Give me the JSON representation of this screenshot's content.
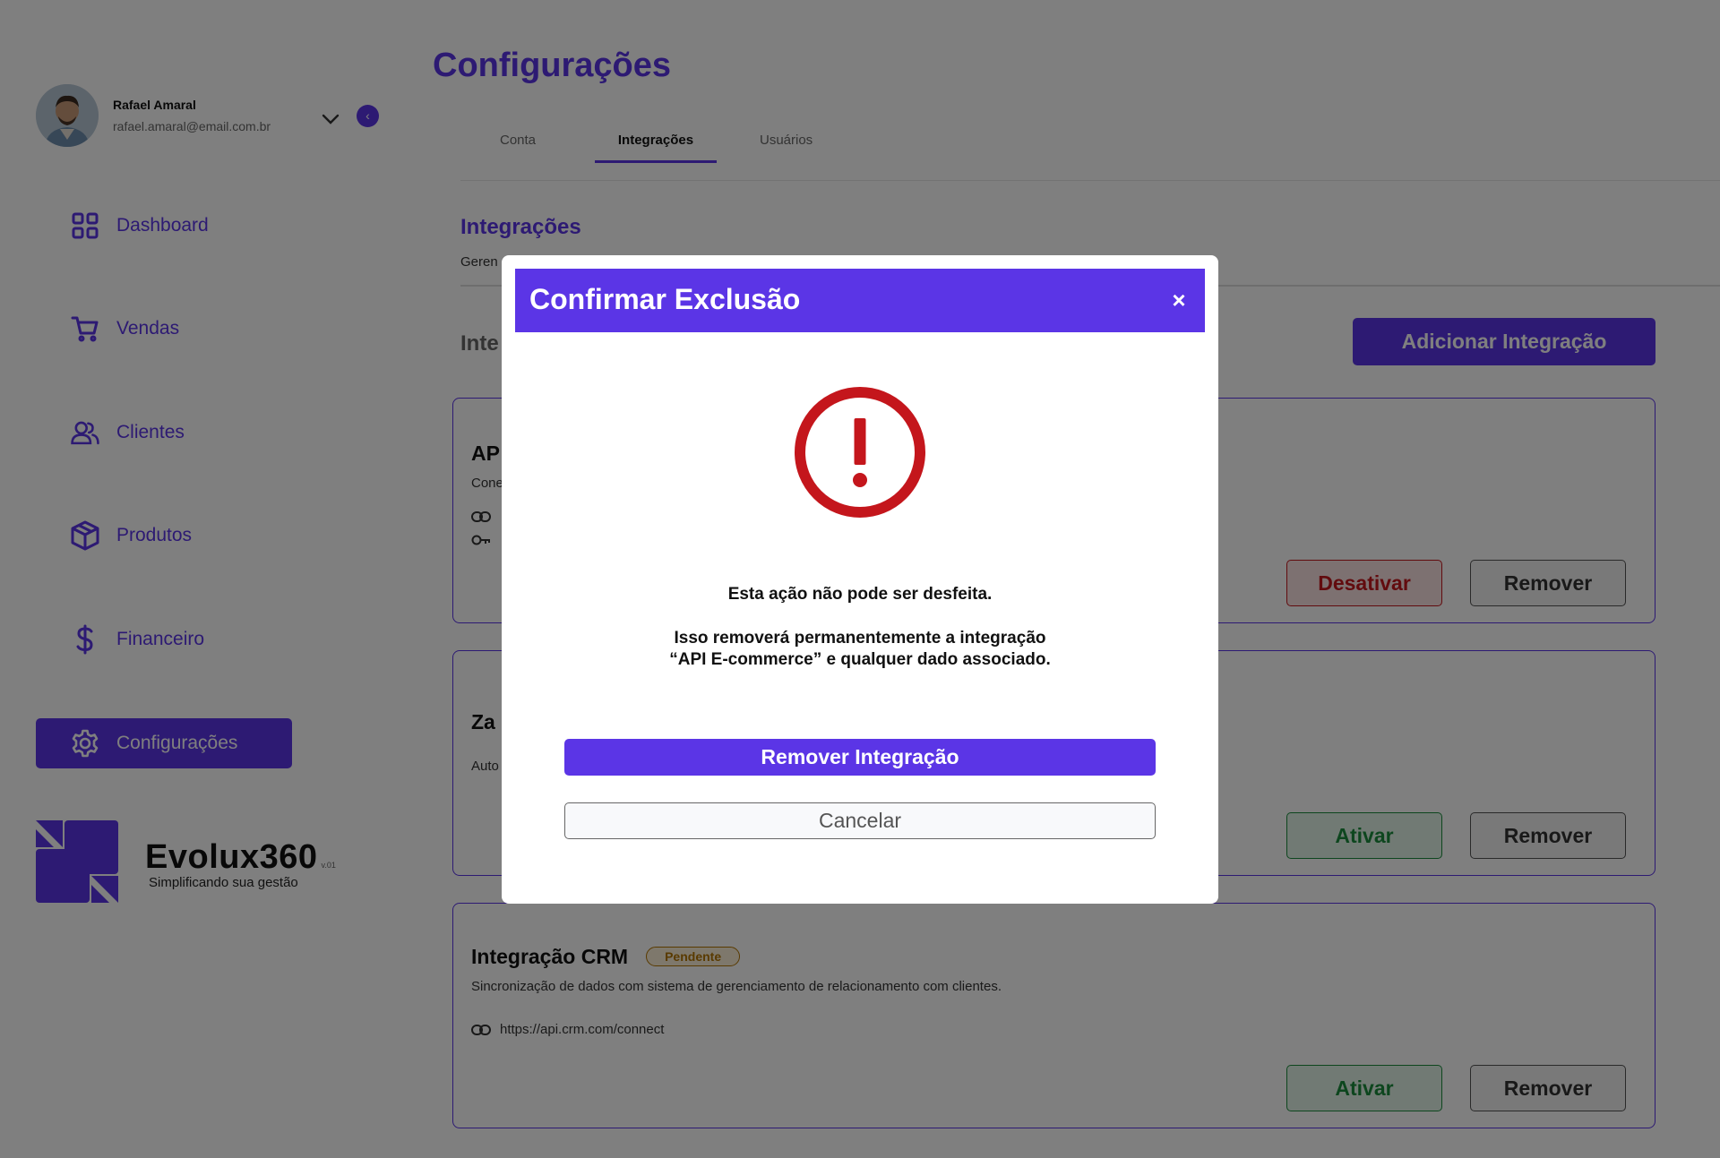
{
  "profile": {
    "name": "Rafael Amaral",
    "email": "rafael.amaral@email.com.br"
  },
  "sidebar": {
    "items": [
      {
        "label": "Dashboard",
        "icon": "grid-icon"
      },
      {
        "label": "Vendas",
        "icon": "cart-icon"
      },
      {
        "label": "Clientes",
        "icon": "users-icon"
      },
      {
        "label": "Produtos",
        "icon": "box-icon"
      },
      {
        "label": "Financeiro",
        "icon": "dollar-icon"
      },
      {
        "label": "Configurações",
        "icon": "gear-icon",
        "active": true
      }
    ],
    "collapse_glyph": "‹"
  },
  "brand": {
    "name": "Evolux360",
    "version": "v.01",
    "tagline": "Simplificando sua gestão"
  },
  "page": {
    "title": "Configurações"
  },
  "tabs": [
    {
      "label": "Conta"
    },
    {
      "label": "Integrações",
      "active": true
    },
    {
      "label": "Usuários"
    }
  ],
  "section": {
    "title": "Integrações",
    "desc": "Geren",
    "list_title": "Inte",
    "add_button": "Adicionar Integração"
  },
  "cards": [
    {
      "title": "AP",
      "desc": "Cone",
      "primary_button": "Desativar",
      "remove_button": "Remover"
    },
    {
      "title": "Za",
      "desc": "Auto",
      "primary_button": "Ativar",
      "remove_button": "Remover"
    },
    {
      "title": "Integração CRM",
      "status": "Pendente",
      "desc": "Sincronização de dados com sistema de gerenciamento de relacionamento com clientes.",
      "url": "https://api.crm.com/connect",
      "primary_button": "Ativar",
      "remove_button": "Remover"
    }
  ],
  "modal": {
    "title": "Confirmar Exclusão",
    "close": "×",
    "warning": "Esta ação não pode ser desfeita.",
    "message_line1": "Isso removerá permanentemente a integração",
    "message_line2": "“API E-commerce” e qualquer dado associado.",
    "confirm": "Remover Integração",
    "cancel": "Cancelar"
  },
  "colors": {
    "primary": "#5b35e6",
    "danger": "#c4161c",
    "success": "#1a8c3c",
    "warning": "#b37400"
  }
}
